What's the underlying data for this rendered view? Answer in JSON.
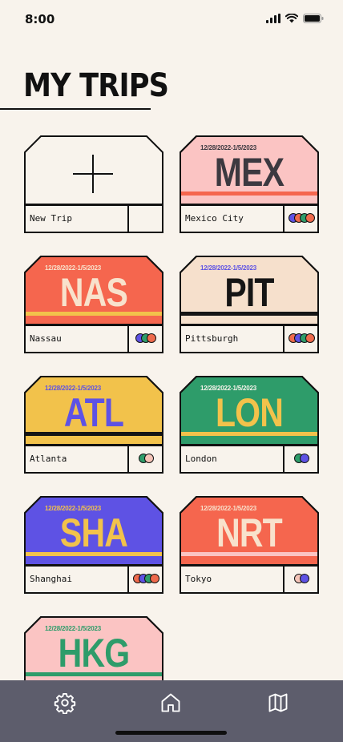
{
  "status": {
    "time": "8:00"
  },
  "page": {
    "title": "MY TRIPS"
  },
  "new_trip": {
    "label": "New Trip"
  },
  "trips": [
    {
      "code": "MEX",
      "city": "Mexico City",
      "dates": "12/28/2022-1/5/2023",
      "bg": "#fbc4c3",
      "code_color": "#3c3940",
      "date_color": "#3c3940",
      "stripe": "#f5664e",
      "stripe2": null,
      "avatars": [
        "#5e52e4",
        "#ee6a4c",
        "#2e9c6a",
        "#ee6a4c"
      ]
    },
    {
      "code": "NAS",
      "city": "Nassau",
      "dates": "12/28/2022-1/5/2023",
      "bg": "#f5664e",
      "code_color": "#f8e2cc",
      "date_color": "#f8e2cc",
      "stripe": "#f2c24b",
      "stripe2": null,
      "avatars": [
        "#5e52e4",
        "#2e9c6a",
        "#ee6a4c"
      ]
    },
    {
      "code": "PIT",
      "city": "Pittsburgh",
      "dates": "12/28/2022-1/5/2023",
      "bg": "#f6e0cc",
      "code_color": "#151515",
      "date_color": "#5e52e4",
      "stripe": "#151515",
      "stripe2": null,
      "avatars": [
        "#ee6a4c",
        "#5e52e4",
        "#2e9c6a",
        "#ee6a4c"
      ]
    },
    {
      "code": "ATL",
      "city": "Atlanta",
      "dates": "12/28/2022-1/5/2023",
      "bg": "#f2c24b",
      "code_color": "#5e52e4",
      "date_color": "#5e52e4",
      "stripe": "#151515",
      "stripe2": null,
      "avatars": [
        "#2e9c6a",
        "#f5c4b8"
      ]
    },
    {
      "code": "LON",
      "city": "London",
      "dates": "12/28/2022-1/5/2023",
      "bg": "#2e9c6a",
      "code_color": "#f2c24b",
      "date_color": "#f8f3ec",
      "stripe": "#f2c24b",
      "stripe2": null,
      "avatars": [
        "#2e9c6a",
        "#5e52e4"
      ]
    },
    {
      "code": "SHA",
      "city": "Shanghai",
      "dates": "12/28/2022-1/5/2023",
      "bg": "#5e52e4",
      "code_color": "#f2c24b",
      "date_color": "#f2c24b",
      "stripe": "#f2c24b",
      "stripe2": null,
      "avatars": [
        "#ee6a4c",
        "#5e52e4",
        "#2e9c6a",
        "#ee6a4c"
      ]
    },
    {
      "code": "NRT",
      "city": "Tokyo",
      "dates": "12/28/2022-1/5/2023",
      "bg": "#f5664e",
      "code_color": "#f8e2cc",
      "date_color": "#f8e2cc",
      "stripe": "#fbc4c3",
      "stripe2": null,
      "avatars": [
        "#f5c4b8",
        "#5e52e4"
      ]
    },
    {
      "code": "HKG",
      "city": "",
      "dates": "12/28/2022-1/5/2023",
      "bg": "#fbc4c3",
      "code_color": "#2e9c6a",
      "date_color": "#2e9c6a",
      "stripe": "#2e9c6a",
      "stripe2": null,
      "avatars": []
    }
  ],
  "tabs": [
    {
      "name": "settings",
      "icon": "gear-icon"
    },
    {
      "name": "home",
      "icon": "home-icon"
    },
    {
      "name": "map",
      "icon": "map-icon"
    }
  ],
  "colors": {
    "background": "#f8f3ec",
    "tab_bar": "#5d5d6c",
    "ink": "#111111"
  }
}
